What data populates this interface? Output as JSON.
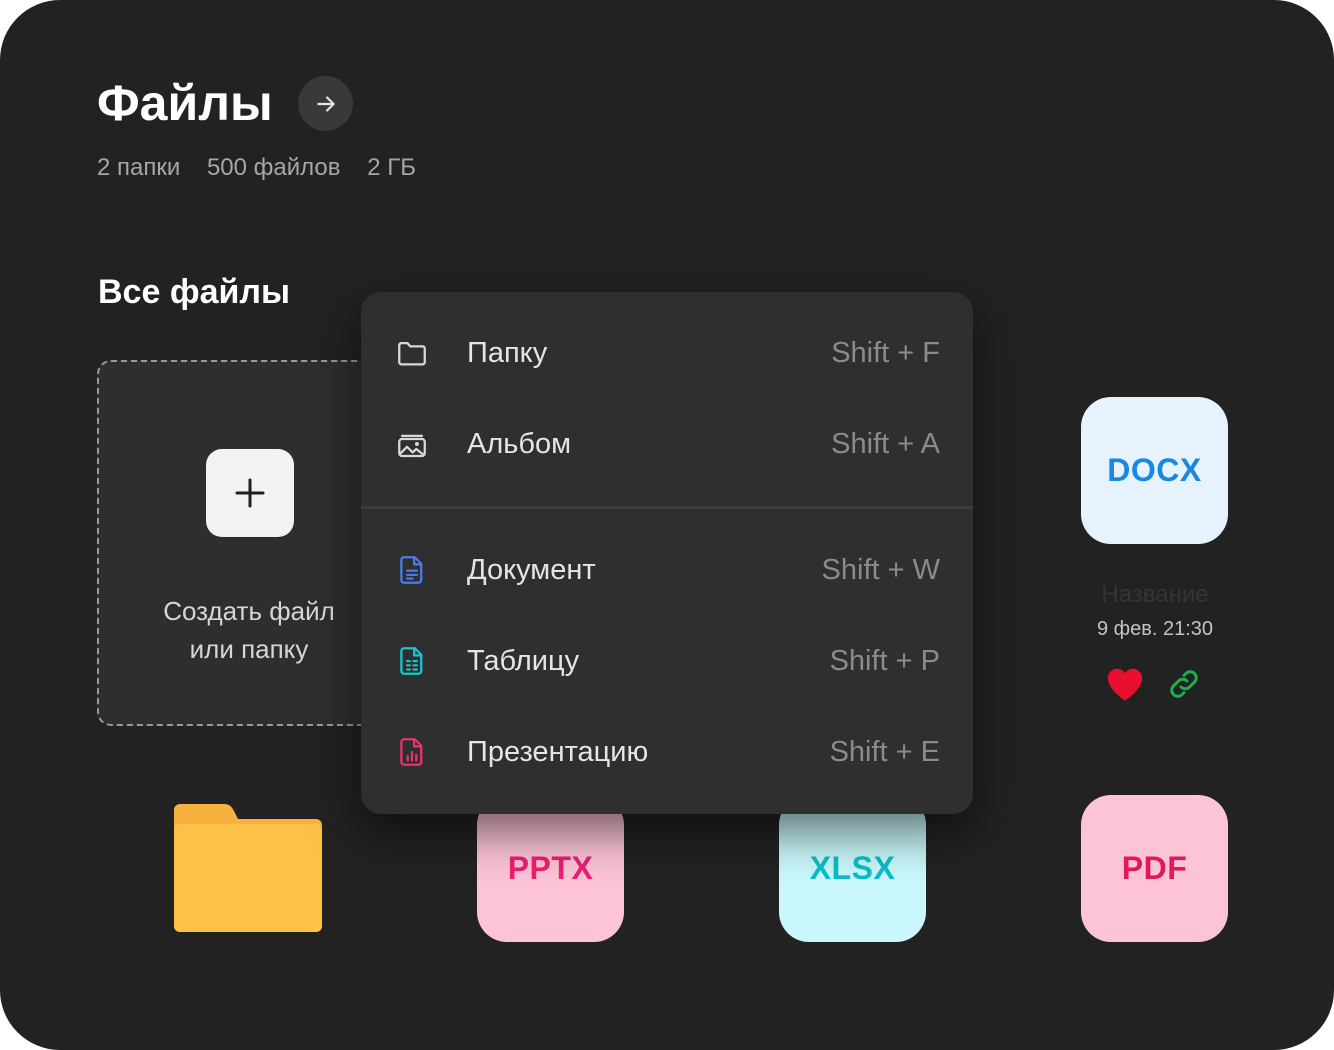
{
  "header": {
    "title": "Файлы"
  },
  "meta": {
    "folders": "2 папки",
    "files": "500 файлов",
    "size": "2 ГБ"
  },
  "section": {
    "title": "Все файлы"
  },
  "create": {
    "label": "Создать файл\nили папку"
  },
  "menu": {
    "items": [
      {
        "label": "Папку",
        "shortcut": "Shift + F",
        "icon": "folder-icon"
      },
      {
        "label": "Альбом",
        "shortcut": "Shift + A",
        "icon": "album-icon"
      },
      {
        "label": "Документ",
        "shortcut": "Shift + W",
        "icon": "document-icon",
        "color": "#4a7cf0"
      },
      {
        "label": "Таблицу",
        "shortcut": "Shift + P",
        "icon": "spreadsheet-icon",
        "color": "#17c6d1"
      },
      {
        "label": "Презентацию",
        "shortcut": "Shift + E",
        "icon": "presentation-icon",
        "color": "#e8336e"
      }
    ]
  },
  "files": {
    "docx": {
      "label": "DOCX",
      "name": "Название",
      "date": "9 фев. 21:30"
    },
    "pptx": {
      "label": "PPTX"
    },
    "xlsx": {
      "label": "XLSX"
    },
    "pdf": {
      "label": "PDF"
    }
  },
  "colors": {
    "background": "#222222",
    "favorite": "#e8102e",
    "link": "#1fae4a",
    "folder": "#fcc146"
  }
}
